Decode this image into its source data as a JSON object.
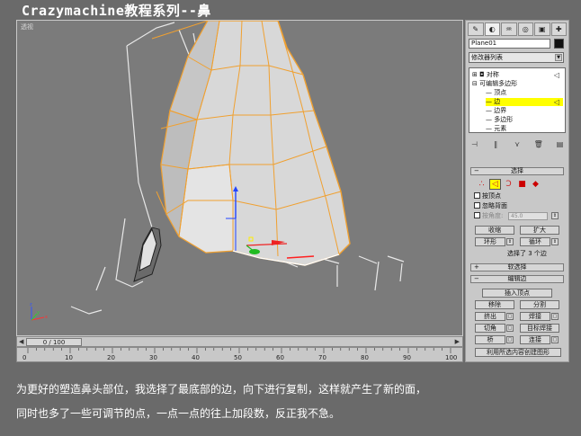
{
  "title": "Crazymachine教程系列--鼻",
  "viewport": {
    "label": "透视"
  },
  "timeline": {
    "frame_label": "0 / 100",
    "ruler_ticks": [
      "0",
      "10",
      "20",
      "30",
      "40",
      "50",
      "60",
      "70",
      "80",
      "90",
      "100"
    ]
  },
  "command_panel": {
    "tabs": [
      {
        "icon": "create-icon",
        "glyph": "✎"
      },
      {
        "icon": "modify-icon",
        "glyph": "◐"
      },
      {
        "icon": "hierarchy-icon",
        "glyph": "♒"
      },
      {
        "icon": "motion-icon",
        "glyph": "◎"
      },
      {
        "icon": "display-icon",
        "glyph": "▣"
      },
      {
        "icon": "utilities-icon",
        "glyph": "✚"
      }
    ],
    "object_name": "Plane01",
    "object_color": "#111111",
    "modifier_list": "修改器列表",
    "stack": [
      {
        "label": "对称",
        "indent": 0,
        "prefix": "⊞ ◘ ",
        "selected": false
      },
      {
        "label": "可编辑多边形",
        "indent": 0,
        "prefix": "⊟ ",
        "selected": false
      },
      {
        "label": "顶点",
        "indent": 1,
        "prefix": "",
        "selected": false
      },
      {
        "label": "边",
        "indent": 1,
        "prefix": "",
        "selected": true
      },
      {
        "label": "边界",
        "indent": 1,
        "prefix": "",
        "selected": false
      },
      {
        "label": "多边形",
        "indent": 1,
        "prefix": "",
        "selected": false
      },
      {
        "label": "元素",
        "indent": 1,
        "prefix": "",
        "selected": false
      }
    ],
    "stack_tools": [
      "⊣",
      "‖",
      "⋎",
      "🗑",
      "▤"
    ],
    "selection": {
      "header": "选择",
      "modes": [
        {
          "name": "vertex-mode-icon",
          "glyph": "∴",
          "color": "#cc2222",
          "active": false
        },
        {
          "name": "edge-mode-icon",
          "glyph": "◁",
          "color": "#cc2222",
          "active": true
        },
        {
          "name": "border-mode-icon",
          "glyph": "Ɔ",
          "color": "#cc2222",
          "active": false
        },
        {
          "name": "polygon-mode-icon",
          "glyph": "■",
          "color": "#cc0000",
          "active": false
        },
        {
          "name": "element-mode-icon",
          "glyph": "◆",
          "color": "#cc0000",
          "active": false
        }
      ],
      "by_vertex": "按顶点",
      "ignore_backfacing": "忽略背面",
      "by_angle": "按角度:",
      "angle_value": "45.0",
      "shrink": "收缩",
      "grow": "扩大",
      "ring": "环形",
      "loop": "循环",
      "status": "选择了 3 个边"
    },
    "soft_selection": {
      "header": "软选择"
    },
    "edit_edges": {
      "header": "编辑边",
      "insert_vertex": "插入顶点",
      "remove": "移除",
      "split": "分割",
      "extrude": "挤出",
      "weld": "焊接",
      "chamfer": "切角",
      "target_weld": "目标焊接",
      "bridge": "桥",
      "connect": "连接",
      "create_shape": "利用所选内容创建图形"
    }
  },
  "caption": {
    "line1": "为更好的塑造鼻头部位，我选择了最底部的边，向下进行复制，这样就产生了新的面，",
    "line2": "同时也多了一些可调节的点，一点一点的往上加段数，反正我不急。"
  },
  "colors": {
    "background": "#6a6a6a",
    "viewport": "#7b7b7b",
    "edge_highlight": "#f0a030",
    "selection": "#ffff00"
  }
}
